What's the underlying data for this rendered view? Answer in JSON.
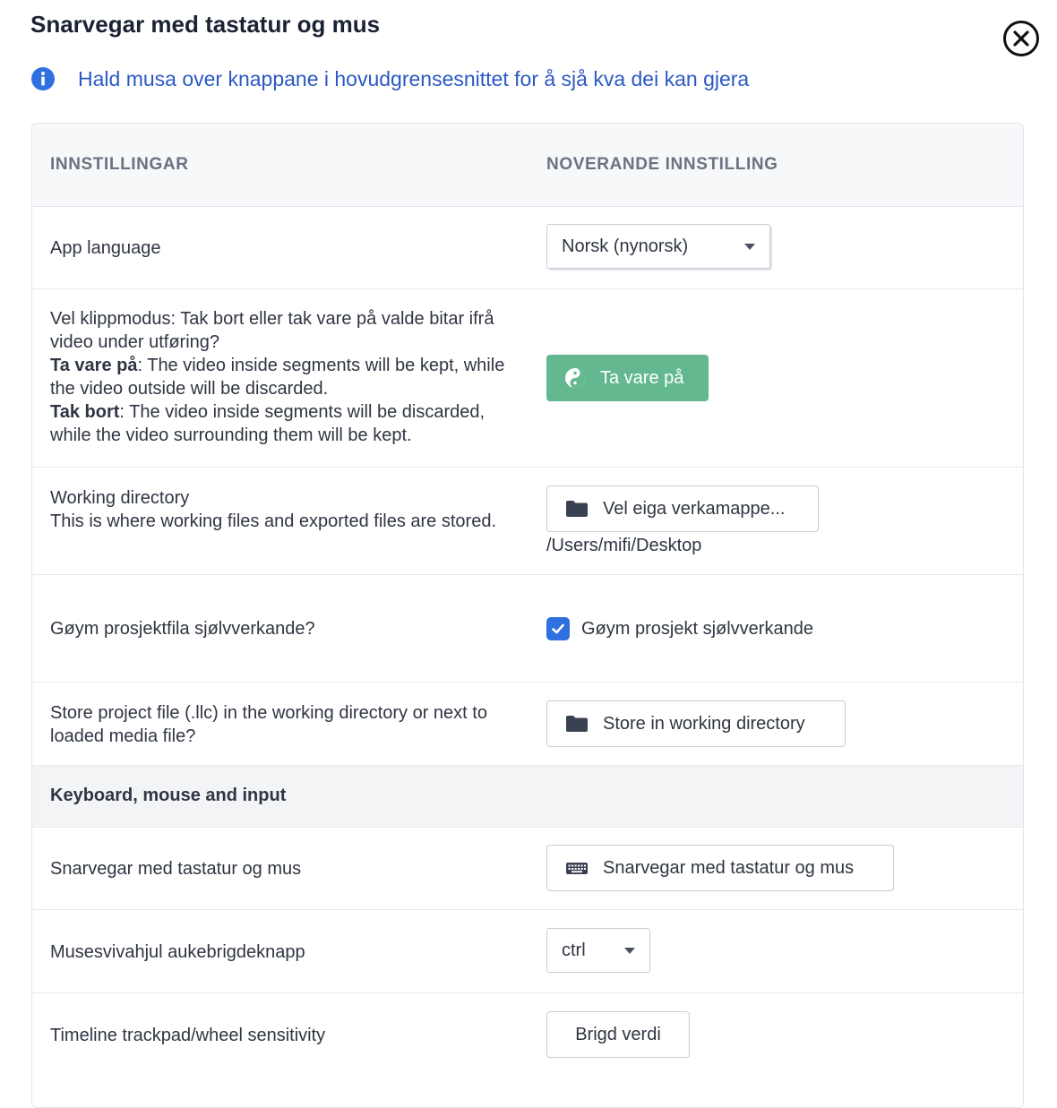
{
  "dialog": {
    "title": "Snarvegar med tastatur og mus",
    "info": "Hald musa over knappane i hovudgrensesnittet for å sjå kva dei kan gjera"
  },
  "table": {
    "col_settings": "INNSTILLINGAR",
    "col_current": "NOVERANDE INNSTILLING"
  },
  "rows": {
    "app_language": {
      "label": "App language",
      "value": "Norsk (nynorsk)"
    },
    "cut_mode": {
      "label_intro": "Vel klippmodus: Tak bort eller tak vare på valde bitar ifrå video under utføring?",
      "keep_title": "Ta vare på",
      "keep_desc": ": The video inside segments will be kept, while the video outside will be discarded.",
      "remove_title": "Tak bort",
      "remove_desc": ": The video inside segments will be discarded, while the video surrounding them will be kept.",
      "button": "Ta vare på"
    },
    "working_dir": {
      "label_title": "Working directory",
      "label_desc": "This is where working files and exported files are stored.",
      "button": "Vel eiga verkamappe...",
      "path": "/Users/mifi/Desktop"
    },
    "autosave": {
      "label": "Gøym prosjektfila sjølvverkande?",
      "checkbox_label": "Gøym prosjekt sjølvverkande",
      "checked": true
    },
    "project_store": {
      "label": "Store project file (.llc) in the working directory or next to loaded media file?",
      "button": "Store in working directory"
    },
    "section_keyboard": "Keyboard, mouse and input",
    "shortcuts": {
      "label": "Snarvegar med tastatur og mus",
      "button": "Snarvegar med tastatur og mus"
    },
    "wheel_modifier": {
      "label": "Musesvivahjul aukebrigdeknapp",
      "value": "ctrl"
    },
    "sensitivity": {
      "label": "Timeline trackpad/wheel sensitivity",
      "button": "Brigd verdi"
    }
  },
  "colors": {
    "accent_blue": "#2b59c3",
    "checkbox_blue": "#2f6fe0",
    "green_button": "#63b88f"
  }
}
